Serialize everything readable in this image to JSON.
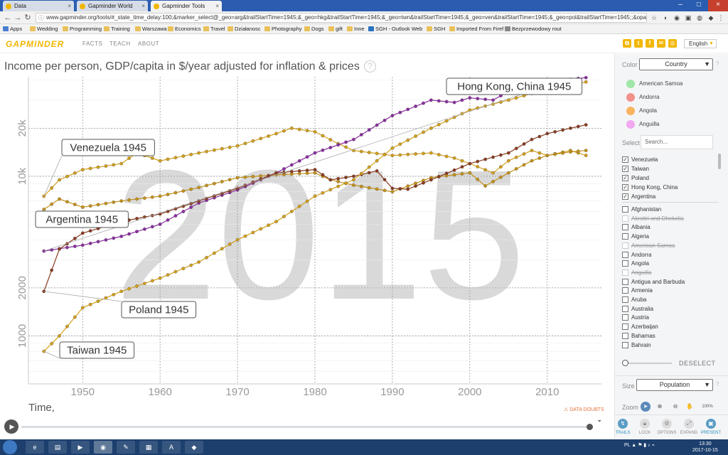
{
  "browser": {
    "tabs": [
      {
        "label": "Data",
        "active": false
      },
      {
        "label": "Gapminder World",
        "active": false
      },
      {
        "label": "Gapminder Tools",
        "active": true
      }
    ],
    "url": "www.gapminder.org/tools/#_state_time_delay:100;&marker_select@_geo=arg&trailStartTime=1945;&_geo=hkg&trailStartTime=1945;&_geo=twn&trailStartTime=1945;&_geo=ven&trailStartTime=1945;&_geo=pol&trailStartTime=1945;;&opacitySelectDi...",
    "bookmarks": [
      "Apps",
      "Wedding",
      "Programming",
      "Training",
      "Warszawa",
      "Economics",
      "Travel",
      "Działanosc",
      "Photography",
      "Dogs",
      "gift",
      "Inne",
      "SGH - Outlook Web",
      "SGH",
      "Imported From Firef",
      "Bezprzewodowy rout"
    ]
  },
  "header": {
    "logo": "GAPMINDER",
    "nav": [
      "FACTS",
      "TEACH",
      "ABOUT"
    ],
    "language": "English"
  },
  "chart_title": "Income per person, GDP/capita in $/year adjusted for inflation & prices",
  "chart_title_help": "?",
  "time_label": "Time,",
  "data_doubts": "DATA DOUBTS",
  "chart_data": {
    "type": "line",
    "title": "Income per person, GDP/capita in $/year adjusted for inflation & prices",
    "xlabel": "Time,",
    "ylabel": "",
    "xlim": [
      1943,
      2017
    ],
    "ylim": [
      500,
      42000
    ],
    "yscale": "log",
    "x_ticks": [
      1950,
      1960,
      1970,
      1980,
      1990,
      2000,
      2010
    ],
    "y_ticks": [
      1000,
      2000,
      10000,
      20000
    ],
    "y_tick_labels": [
      "1000",
      "2000",
      "10k",
      "20k"
    ],
    "watermark": "2015",
    "grid": true,
    "series": [
      {
        "name": "Venezuela",
        "color": "#d4a017",
        "points": [
          [
            1945,
            7500
          ],
          [
            1947,
            9500
          ],
          [
            1950,
            11000
          ],
          [
            1955,
            12000
          ],
          [
            1957,
            14000
          ],
          [
            1960,
            12500
          ],
          [
            1965,
            14000
          ],
          [
            1970,
            15500
          ],
          [
            1975,
            18500
          ],
          [
            1977,
            20000
          ],
          [
            1980,
            19000
          ],
          [
            1983,
            16000
          ],
          [
            1985,
            14500
          ],
          [
            1990,
            13500
          ],
          [
            1995,
            14000
          ],
          [
            1998,
            13000
          ],
          [
            2000,
            12000
          ],
          [
            2003,
            10500
          ],
          [
            2005,
            12500
          ],
          [
            2008,
            14500
          ],
          [
            2010,
            13500
          ],
          [
            2013,
            14500
          ],
          [
            2015,
            13500
          ]
        ]
      },
      {
        "name": "Argentina",
        "color": "#c69214",
        "points": [
          [
            1945,
            6200
          ],
          [
            1947,
            7200
          ],
          [
            1950,
            6400
          ],
          [
            1955,
            7000
          ],
          [
            1960,
            7500
          ],
          [
            1965,
            8500
          ],
          [
            1970,
            9800
          ],
          [
            1975,
            10200
          ],
          [
            1980,
            10500
          ],
          [
            1982,
            9500
          ],
          [
            1985,
            8800
          ],
          [
            1990,
            8000
          ],
          [
            1995,
            9800
          ],
          [
            2000,
            10500
          ],
          [
            2002,
            8700
          ],
          [
            2005,
            10500
          ],
          [
            2008,
            12500
          ],
          [
            2010,
            13500
          ],
          [
            2013,
            14200
          ],
          [
            2015,
            14500
          ]
        ]
      },
      {
        "name": "Hong Kong, China",
        "color": "#8a2ca0",
        "points": [
          [
            1945,
            3400
          ],
          [
            1950,
            3700
          ],
          [
            1955,
            4200
          ],
          [
            1960,
            5000
          ],
          [
            1965,
            6800
          ],
          [
            1970,
            8200
          ],
          [
            1975,
            10500
          ],
          [
            1980,
            14000
          ],
          [
            1985,
            17000
          ],
          [
            1990,
            24000
          ],
          [
            1995,
            30000
          ],
          [
            1998,
            29000
          ],
          [
            2000,
            31000
          ],
          [
            2003,
            30000
          ],
          [
            2005,
            34000
          ],
          [
            2008,
            38000
          ],
          [
            2010,
            39000
          ],
          [
            2013,
            40500
          ],
          [
            2015,
            41500
          ]
        ]
      },
      {
        "name": "Poland",
        "color": "#8b3a1e",
        "points": [
          [
            1945,
            1900
          ],
          [
            1947,
            3500
          ],
          [
            1950,
            4400
          ],
          [
            1955,
            5200
          ],
          [
            1960,
            5800
          ],
          [
            1965,
            7000
          ],
          [
            1970,
            8400
          ],
          [
            1975,
            10500
          ],
          [
            1980,
            11000
          ],
          [
            1982,
            9500
          ],
          [
            1985,
            10000
          ],
          [
            1988,
            10800
          ],
          [
            1990,
            8400
          ],
          [
            1992,
            8300
          ],
          [
            1995,
            9500
          ],
          [
            2000,
            12000
          ],
          [
            2005,
            14000
          ],
          [
            2008,
            17000
          ],
          [
            2010,
            18500
          ],
          [
            2013,
            20000
          ],
          [
            2015,
            21000
          ]
        ]
      },
      {
        "name": "Taiwan",
        "color": "#d4a017",
        "points": [
          [
            1945,
            800
          ],
          [
            1947,
            1000
          ],
          [
            1950,
            1500
          ],
          [
            1955,
            1900
          ],
          [
            1960,
            2300
          ],
          [
            1965,
            2900
          ],
          [
            1970,
            4000
          ],
          [
            1975,
            5200
          ],
          [
            1980,
            7500
          ],
          [
            1985,
            9500
          ],
          [
            1990,
            15000
          ],
          [
            1995,
            20000
          ],
          [
            2000,
            26000
          ],
          [
            2005,
            30000
          ],
          [
            2008,
            33000
          ],
          [
            2010,
            35000
          ],
          [
            2013,
            37000
          ],
          [
            2015,
            39000
          ]
        ]
      }
    ],
    "annotations": [
      {
        "text": "Hong Kong, China 1945",
        "series": "Hong Kong, China"
      },
      {
        "text": "Venezuela 1945",
        "series": "Venezuela"
      },
      {
        "text": "Argentina 1945",
        "series": "Argentina"
      },
      {
        "text": "Poland 1945",
        "series": "Poland"
      },
      {
        "text": "Taiwan 1945",
        "series": "Taiwan"
      }
    ]
  },
  "panel": {
    "color_label": "Color",
    "color_value": "Country",
    "legend": [
      {
        "label": "American Samoa",
        "color": "#9fe6a8"
      },
      {
        "label": "Andorra",
        "color": "#f2908a"
      },
      {
        "label": "Angola",
        "color": "#f9b45d"
      },
      {
        "label": "Anguilla",
        "color": "#f0a8f0"
      }
    ],
    "select_label": "Select",
    "search_placeholder": "Search...",
    "selected": [
      "Venezuela",
      "Taiwan",
      "Poland",
      "Hong Kong, China",
      "Argentina"
    ],
    "countries": [
      {
        "label": "Afghanistan",
        "disabled": false
      },
      {
        "label": "Akrotiri and Dhekelia",
        "disabled": true
      },
      {
        "label": "Albania",
        "disabled": false
      },
      {
        "label": "Algeria",
        "disabled": false
      },
      {
        "label": "American Samoa",
        "disabled": true
      },
      {
        "label": "Andorra",
        "disabled": false
      },
      {
        "label": "Angola",
        "disabled": false
      },
      {
        "label": "Anguilla",
        "disabled": true
      },
      {
        "label": "Antigua and Barbuda",
        "disabled": false
      },
      {
        "label": "Armenia",
        "disabled": false
      },
      {
        "label": "Aruba",
        "disabled": false
      },
      {
        "label": "Australia",
        "disabled": false
      },
      {
        "label": "Austria",
        "disabled": false
      },
      {
        "label": "Azerbaijan",
        "disabled": false
      },
      {
        "label": "Bahamas",
        "disabled": false
      },
      {
        "label": "Bahrain",
        "disabled": false
      }
    ],
    "deselect": "DESELECT",
    "size_label": "Size",
    "size_value": "Population",
    "zoom_label": "Zoom",
    "zoom_percent": "100%",
    "tools": [
      "TRAILS",
      "LOCK",
      "OPTIONS",
      "EXPAND",
      "PRESENT"
    ]
  },
  "taskbar": {
    "tray_language": "PL",
    "time": "13:30",
    "date": "2017-10-15"
  }
}
